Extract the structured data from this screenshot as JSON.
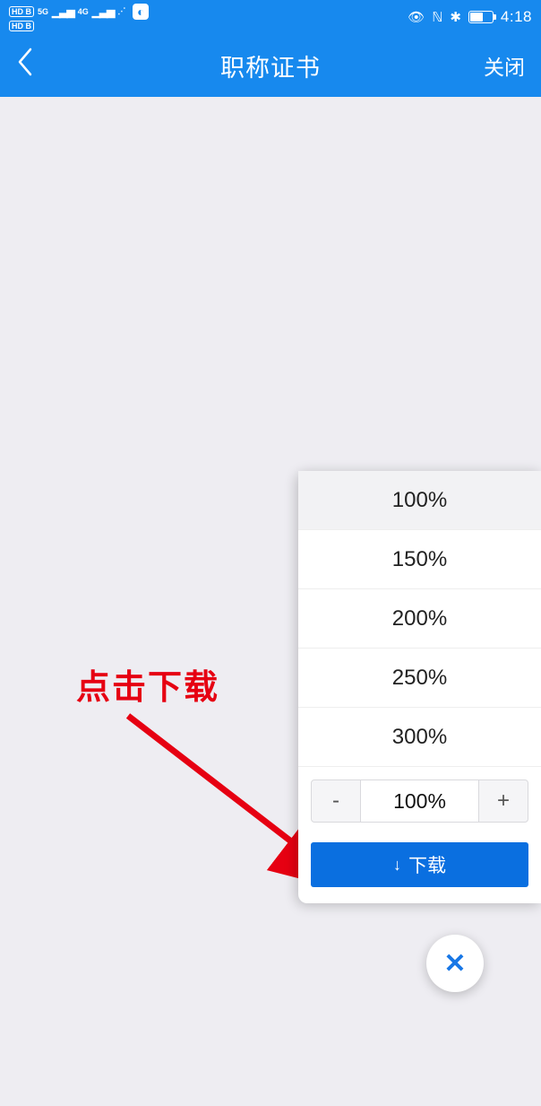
{
  "status": {
    "hd1": "HD B",
    "net1": "5G",
    "hd2": "HD B",
    "net2": "4G",
    "clock": "4:18"
  },
  "nav": {
    "title": "职称证书",
    "close": "关闭"
  },
  "annotation": {
    "label": "点击下载"
  },
  "zoom": {
    "options": {
      "o0": "100%",
      "o1": "150%",
      "o2": "200%",
      "o3": "250%",
      "o4": "300%"
    },
    "current": "100%",
    "minus": "-",
    "plus": "+"
  },
  "download": {
    "label": "下载"
  }
}
